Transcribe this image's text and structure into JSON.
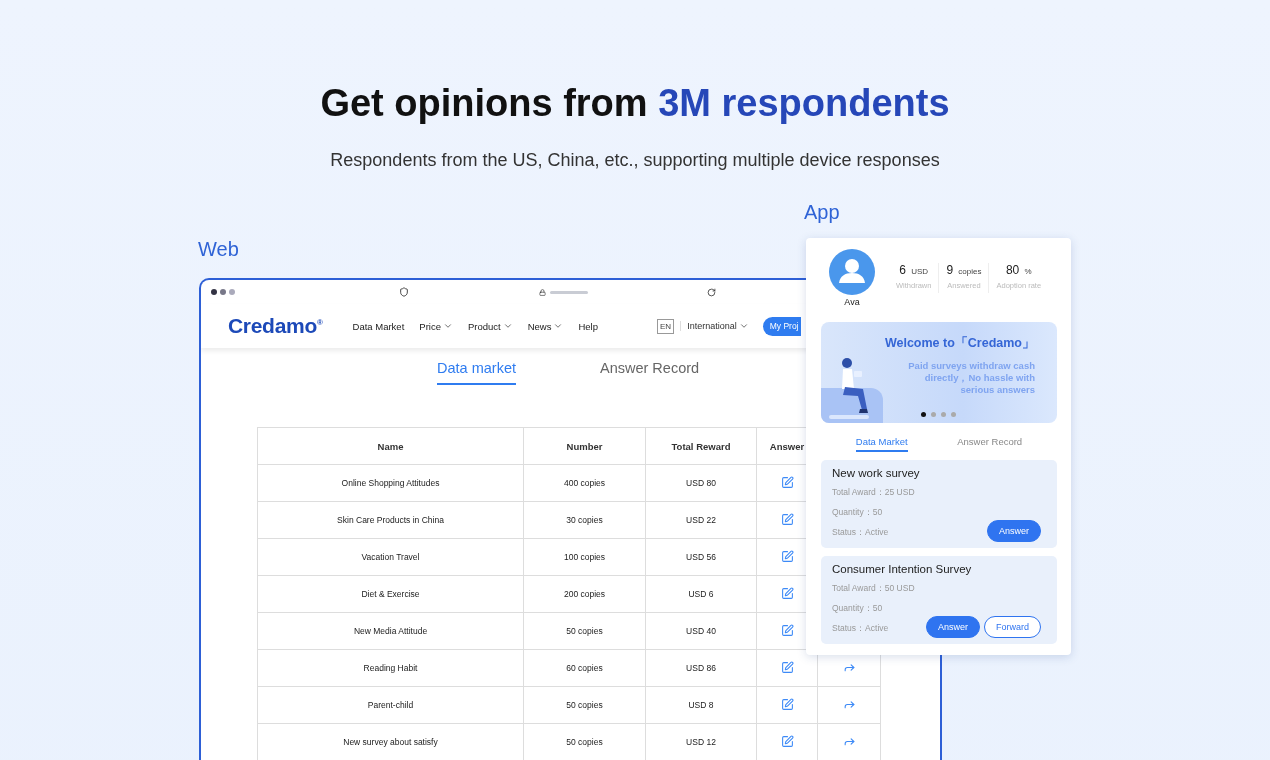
{
  "hero": {
    "title": "Get opinions from",
    "highlight": "3M respondents",
    "subtitle": "Respondents from the US, China, etc., supporting multiple device responses"
  },
  "web": {
    "label": "Web",
    "nav": {
      "logo": "Credamo$^{®}$",
      "items": [
        {
          "label": "Data Market",
          "dropdown": false
        },
        {
          "label": "Price",
          "dropdown": true
        },
        {
          "label": "Product",
          "dropdown": true
        },
        {
          "label": "News",
          "dropdown": true
        },
        {
          "label": "Help",
          "dropdown": false
        }
      ],
      "language": "EN",
      "region": "International",
      "button": "My Proj"
    },
    "tabs": [
      {
        "label": "Data market",
        "selected": true
      },
      {
        "label": "Answer Record",
        "selected": false
      }
    ],
    "table": {
      "columns": [
        "Name",
        "Number",
        "Total Reward",
        "Answer"
      ],
      "rows": [
        {
          "kind": "covered",
          "name": "Online Shopping Attitudes",
          "number": "400 copies",
          "reward": "USD 80"
        },
        {
          "kind": "covered",
          "name": "Skin Care Products in China",
          "number": "30 copies",
          "reward": "USD 22"
        },
        {
          "kind": "covered",
          "name": "Vacation Travel",
          "number": "100 copies",
          "reward": "USD 56"
        },
        {
          "kind": "covered",
          "name": "Diet & Exercise",
          "number": "200 copies",
          "reward": "USD 6"
        },
        {
          "kind": "covered",
          "name": "New Media Attitude",
          "number": "50 copies",
          "reward": "USD 40"
        },
        {
          "kind": "full",
          "name": "Reading Habit",
          "number": "60 copies",
          "reward": "USD 86"
        },
        {
          "kind": "full",
          "name": "Parent-child",
          "number": "50 copies",
          "reward": "USD 8"
        },
        {
          "kind": "full",
          "name": "New survey about satisfy",
          "number": "50 copies",
          "reward": "USD 12"
        }
      ]
    }
  },
  "app": {
    "label": "App",
    "user": "Ava",
    "stats": [
      {
        "value": "6",
        "unit": "USD",
        "caption": "Withdrawn"
      },
      {
        "value": "9",
        "unit": "copies",
        "caption": "Answered"
      },
      {
        "value": "80",
        "unit": "%",
        "caption": "Adoption rate"
      }
    ],
    "banner": {
      "title": "Welcome to「Credamo」",
      "text": "Paid surveys withdraw cash directly，No hassle with serious answers",
      "dots": [
        {
          "selected": true
        },
        {
          "selected": false
        },
        {
          "selected": false
        },
        {
          "selected": false
        }
      ]
    },
    "tabs": [
      {
        "label": "Data Market",
        "selected": true
      },
      {
        "label": "Answer Record",
        "selected": false
      }
    ],
    "surveys": [
      {
        "title": "New work survey",
        "lines": [
          "Total Award：25 USD",
          "Quantity：50",
          "Status：Active"
        ],
        "buttons": [
          {
            "label": "Answer",
            "kind": "primary"
          }
        ]
      },
      {
        "title": "Consumer Intention Survey",
        "lines": [
          "Total Award：50 USD",
          "Quantity：50",
          "Status：Active"
        ],
        "buttons": [
          {
            "label": "Answer",
            "kind": "primary"
          },
          {
            "label": "Forward",
            "kind": "outline"
          }
        ]
      }
    ]
  }
}
